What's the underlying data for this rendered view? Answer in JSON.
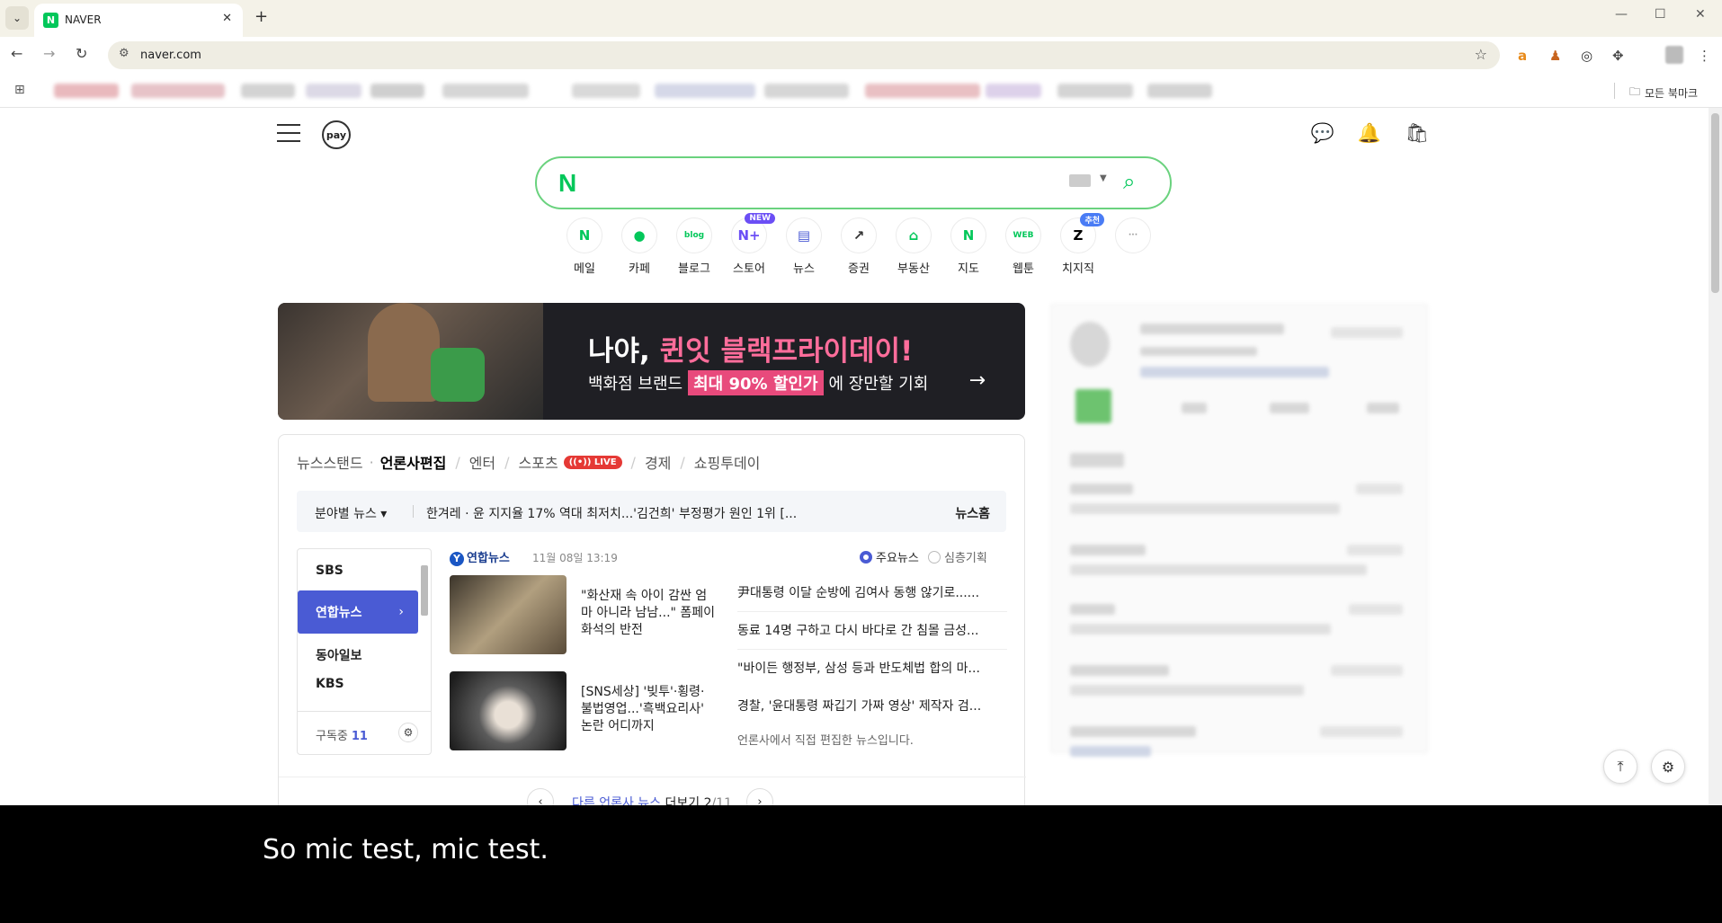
{
  "browser": {
    "tab_title": "NAVER",
    "tab_favicon": "N",
    "url": "naver.com",
    "bookmarks_all": "모든 북마크"
  },
  "header": {
    "pay_label": "pay",
    "search_logo": "N"
  },
  "shortcuts": [
    {
      "label": "메일",
      "icon": "N",
      "color": "#03c75a",
      "badge": ""
    },
    {
      "label": "카페",
      "icon": "●",
      "color": "#03c75a",
      "badge": ""
    },
    {
      "label": "블로그",
      "icon": "blog",
      "color": "#03c75a",
      "badge": ""
    },
    {
      "label": "스토어",
      "icon": "N+",
      "color": "#6b4ef5",
      "badge": "NEW"
    },
    {
      "label": "뉴스",
      "icon": "▤",
      "color": "#4a5bd4",
      "badge": ""
    },
    {
      "label": "증권",
      "icon": "↗",
      "color": "#333333",
      "badge": ""
    },
    {
      "label": "부동산",
      "icon": "⌂",
      "color": "#03c75a",
      "badge": ""
    },
    {
      "label": "지도",
      "icon": "N",
      "color": "#03c75a",
      "badge": ""
    },
    {
      "label": "웹툰",
      "icon": "WEB",
      "color": "#03c75a",
      "badge": ""
    },
    {
      "label": "치지직",
      "icon": "Z",
      "color": "#000000",
      "badge": "추천"
    },
    {
      "label": "",
      "icon": "···",
      "color": "#999999",
      "badge": ""
    }
  ],
  "banner": {
    "title_a": "나야, ",
    "title_b": "퀸잇 블랙프라이데이!",
    "sub_a": "백화점 브랜드",
    "sub_hl": "최대 90% 할인가",
    "sub_b": "에 장만할 기회"
  },
  "news": {
    "tabs": [
      "뉴스스탠드",
      "언론사편집",
      "엔터",
      "스포츠",
      "경제",
      "쇼핑투데이"
    ],
    "live": "LIVE",
    "category": "분야별 뉴스 ▾",
    "headline_text": "한겨레 · 윤 지지율 17% 역대 최저치...'김건희' 부정평가 원인 1위 [...",
    "news_home": "뉴스홈",
    "press": [
      "SBS",
      "연합뉴스",
      "동아일보",
      "KBS"
    ],
    "subscribed_label": "구독중",
    "subscribed_count": "11",
    "publisher": "연합뉴스",
    "date": "11월 08일 13:19",
    "opt_main": "주요뉴스",
    "opt_deep": "심층기획",
    "articles": [
      "\"화산재 속 아이 감싼 엄마 아니라 남남...\" 폼페이 화석의 반전",
      "[SNS세상] '빚투'·횡령·불법영업...'흑백요리사' 논란 어디까지"
    ],
    "headlines": [
      "尹대통령 이달 순방에 김여사 동행 않기로......",
      "동료 14명 구하고 다시 바다로 간 침몰 금성...",
      "\"바이든 행정부, 삼성 등과 반도체법 합의 마...",
      "경찰, '윤대통령 짜깁기 가짜 영상' 제작자 검..."
    ],
    "note": "언론사에서 직접 편집한 뉴스입니다.",
    "pager_a": "다른 언론사 뉴스",
    "pager_b": " 더보기 ",
    "pager_page": "2",
    "pager_total": "/11"
  },
  "caption": "So mic test, mic test."
}
